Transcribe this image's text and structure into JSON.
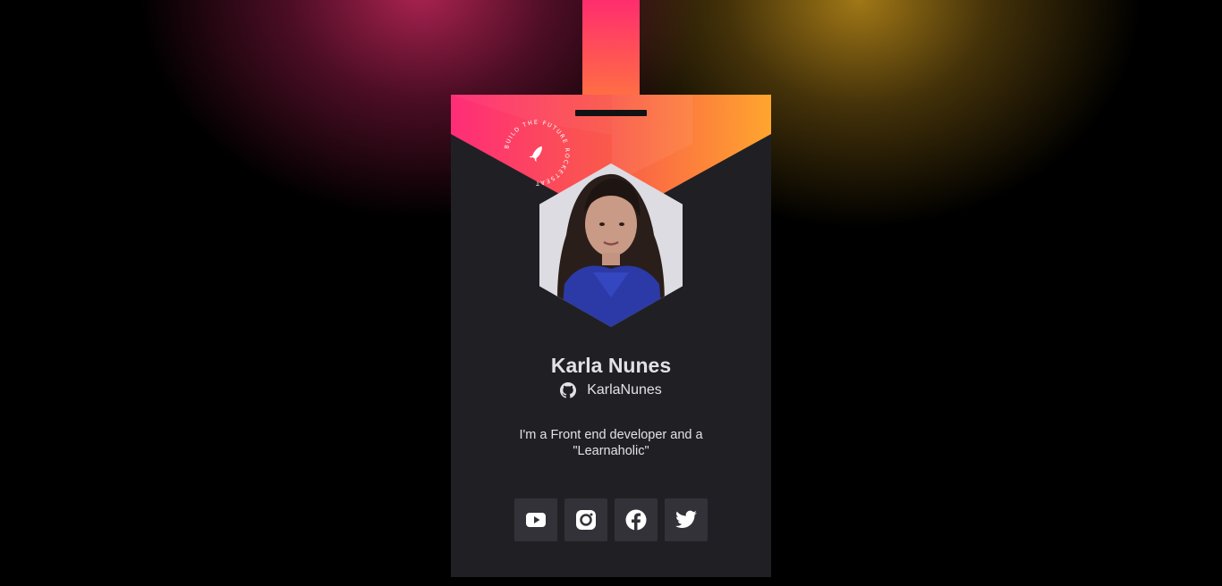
{
  "profile": {
    "name": "Karla Nunes",
    "github_user": "KarlaNunes",
    "bio": "I'm a Front end developer and a \"Learnaholic\""
  },
  "seal": {
    "text": "BUILD THE FUTURE  ROCKETSEAT",
    "icon": "rocket-icon"
  },
  "socials": [
    {
      "label": "YouTube",
      "icon": "youtube-icon"
    },
    {
      "label": "Instagram",
      "icon": "instagram-icon"
    },
    {
      "label": "Facebook",
      "icon": "facebook-icon"
    },
    {
      "label": "Twitter",
      "icon": "twitter-icon"
    }
  ],
  "colors": {
    "background": "#000000",
    "card": "#202024",
    "button": "#323238",
    "text": "#E1E1E6",
    "gradient_start": "#FF2D6E",
    "gradient_end": "#FFA52E"
  }
}
